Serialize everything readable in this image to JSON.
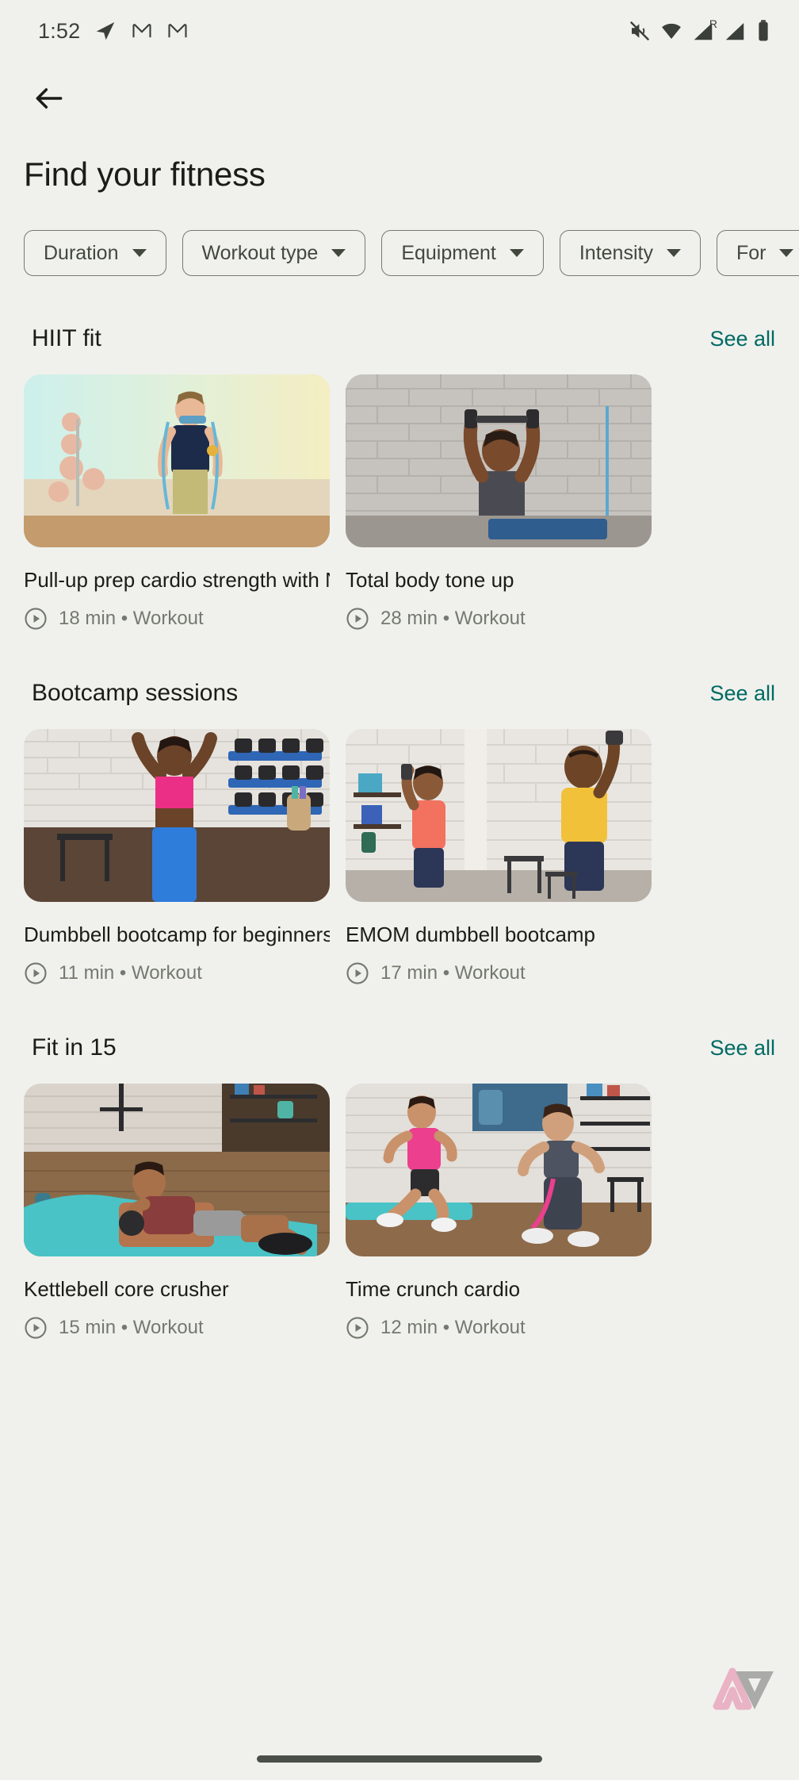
{
  "status_bar": {
    "time": "1:52",
    "left_icons": [
      "telegram-icon",
      "gmail-icon",
      "gmail-icon"
    ],
    "right_icons": [
      "mute-icon",
      "wifi-icon",
      "signal-roaming-icon",
      "signal-icon",
      "battery-icon"
    ],
    "roaming_label": "R"
  },
  "app_bar": {
    "back_icon": "back-arrow-icon",
    "title": "Find your fitness"
  },
  "filters": {
    "chips": [
      {
        "label": "Duration",
        "icon": "chevron-down-icon"
      },
      {
        "label": "Workout type",
        "icon": "chevron-down-icon"
      },
      {
        "label": "Equipment",
        "icon": "chevron-down-icon"
      },
      {
        "label": "Intensity",
        "icon": "chevron-down-icon"
      },
      {
        "label": "For",
        "icon": "chevron-down-icon"
      }
    ]
  },
  "colors": {
    "background": "#f0f1ed",
    "accent_link": "#006a63",
    "primary_text": "#1b1c18",
    "secondary_text": "#74796f",
    "chip_outline": "#74796f",
    "watermark_pink": "#e58cae",
    "watermark_gray": "#808080"
  },
  "sections": [
    {
      "title": "HIIT fit",
      "see_all": "See all",
      "cards": [
        {
          "title": "Pull-up prep cardio strength with Natalie",
          "duration": "18 min",
          "separator": "•",
          "category": "Workout",
          "meta": "18 min • Workout",
          "play_icon": "play-circle-icon",
          "thumb": "pastel-gradient-resistance-band"
        },
        {
          "title": "Total body tone up",
          "duration": "28 min",
          "separator": "•",
          "category": "Workout",
          "meta": "28 min • Workout",
          "play_icon": "play-circle-icon",
          "thumb": "brick-gym-overhead-press"
        }
      ]
    },
    {
      "title": "Bootcamp sessions",
      "see_all": "See all",
      "cards": [
        {
          "title": "Dumbbell bootcamp for beginners",
          "duration": "11 min",
          "separator": "•",
          "category": "Workout",
          "meta": "11 min • Workout",
          "play_icon": "play-circle-icon",
          "thumb": "gym-pink-top-arms-up"
        },
        {
          "title": "EMOM dumbbell bootcamp",
          "duration": "17 min",
          "separator": "•",
          "category": "Workout",
          "meta": "17 min • Workout",
          "play_icon": "play-circle-icon",
          "thumb": "two-men-dumbbell-press"
        }
      ]
    },
    {
      "title": "Fit in 15",
      "see_all": "See all",
      "cards": [
        {
          "title": "Kettlebell core crusher",
          "duration": "15 min",
          "separator": "•",
          "category": "Workout",
          "meta": "15 min • Workout",
          "play_icon": "play-circle-icon",
          "thumb": "man-kettlebell-situp-mat"
        },
        {
          "title": "Time crunch cardio",
          "duration": "12 min",
          "separator": "•",
          "category": "Workout",
          "meta": "12 min • Workout",
          "play_icon": "play-circle-icon",
          "thumb": "two-people-cardio-lunge"
        }
      ]
    }
  ],
  "watermark": {
    "name": "android-police-logo"
  },
  "nav": {
    "handle": "gesture-handle"
  }
}
